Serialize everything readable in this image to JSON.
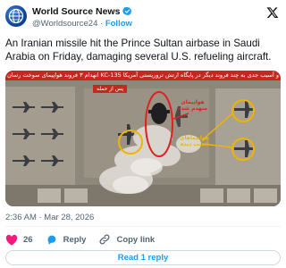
{
  "author": {
    "name": "World Source News",
    "handle": "@Worldsource24",
    "separator": "·",
    "follow_label": "Follow"
  },
  "tweet": {
    "text": "An Iranian missile hit the Prince Sultan airbase in Saudi Arabia on Friday, damaging several U.S. refueling aircraft.",
    "timestamp": "2:36 AM · Mar 28, 2026"
  },
  "media": {
    "banner_text": "انهدام ۳ فروند هواپیمای سوخت رسان KC-135 و آسیب جدی به چند فروند دیگر در پایگاه ارتش تروریستی آمریکا",
    "pre_label": "پس از حمله",
    "hit_label_line1": "هواپیمای",
    "hit_label_line2": "منهدم شده",
    "damaged_label_line1": "هواپیماهای",
    "damaged_label_line2": "آسیب دیده",
    "colors": {
      "banner": "#c4281f",
      "hit_circle": "#e02020",
      "damaged_circle": "#f0b400"
    }
  },
  "actions": {
    "like_count": "26",
    "reply_label": "Reply",
    "copy_link_label": "Copy link"
  },
  "read_replies_label": "Read 1 reply",
  "colors": {
    "accent": "#1d9bf0",
    "like": "#f91880",
    "muted": "#536471"
  }
}
